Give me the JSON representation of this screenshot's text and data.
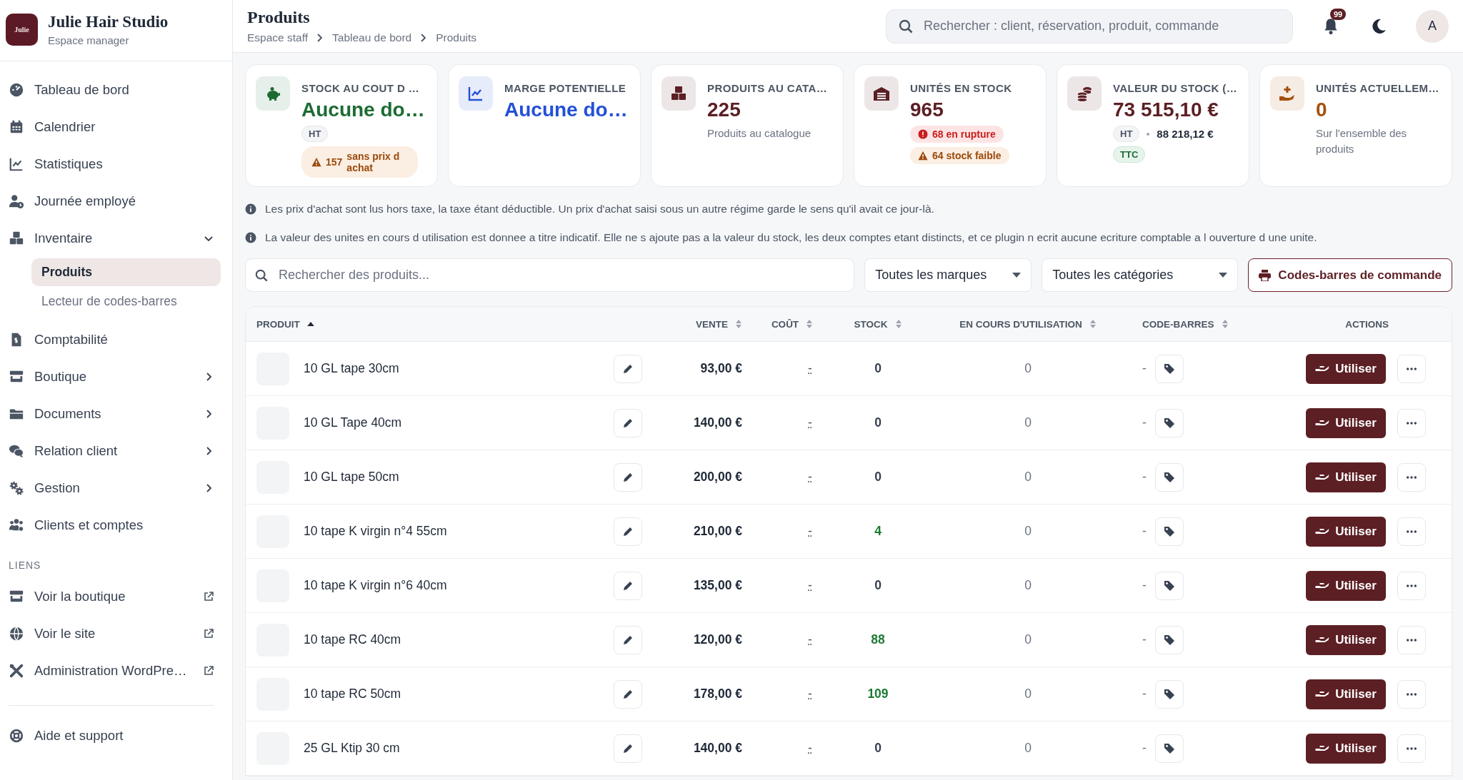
{
  "brand": {
    "logo_text": "Julie",
    "name": "Julie Hair Studio",
    "subtitle": "Espace manager"
  },
  "nav": [
    {
      "label": "Tableau de bord"
    },
    {
      "label": "Calendrier"
    },
    {
      "label": "Statistiques"
    },
    {
      "label": "Journée employé"
    },
    {
      "label": "Inventaire",
      "expanded": true,
      "children": [
        {
          "label": "Produits",
          "selected": true
        },
        {
          "label": "Lecteur de codes-barres",
          "selected": false
        }
      ]
    },
    {
      "label": "Comptabilité"
    },
    {
      "label": "Boutique",
      "expanded": false
    },
    {
      "label": "Documents",
      "expanded": false
    },
    {
      "label": "Relation client",
      "expanded": false
    },
    {
      "label": "Gestion",
      "expanded": false
    },
    {
      "label": "Clients et comptes"
    }
  ],
  "links_heading": "LIENS",
  "links": [
    {
      "label": "Voir la boutique"
    },
    {
      "label": "Voir le site"
    },
    {
      "label": "Administration WordPre…"
    }
  ],
  "help": {
    "label": "Aide et support"
  },
  "header": {
    "title": "Produits",
    "breadcrumb": [
      "Espace staff",
      "Tableau de bord",
      "Produits"
    ],
    "search_placeholder": "Rechercher : client, réservation, produit, commande",
    "notifications": "99",
    "avatar": "A"
  },
  "cards": [
    {
      "title": "STOCK AU COUT D …",
      "value": "Aucune do…",
      "color": "#1d6b33",
      "rows": [
        {
          "items": [
            {
              "kind": "tag",
              "text": "HT"
            }
          ]
        },
        {
          "items": [
            {
              "kind": "warning",
              "count": "157",
              "text": "sans prix d achat"
            }
          ]
        }
      ]
    },
    {
      "title": "MARGE POTENTIELLE",
      "value": "Aucune do…",
      "color": "#2350d8"
    },
    {
      "title": "PRODUITS AU CATA…",
      "value": "225",
      "color": "#5c1f24",
      "rows": [
        {
          "items": [
            {
              "kind": "note",
              "text": "Produits au catalogue"
            }
          ]
        }
      ]
    },
    {
      "title": "UNITÉS EN STOCK",
      "value": "965",
      "color": "#5c1f24",
      "rows": [
        {
          "items": [
            {
              "kind": "error",
              "text": "68 en rupture"
            }
          ]
        },
        {
          "items": [
            {
              "kind": "warning",
              "text": "64 stock faible"
            }
          ]
        }
      ]
    },
    {
      "title": "VALEUR DU STOCK (…",
      "value": "73 515,10 €",
      "color": "#5c1f24",
      "rows": [
        {
          "items": [
            {
              "kind": "tag",
              "text": "HT"
            },
            {
              "kind": "amount",
              "text": "88 218,12 €"
            }
          ]
        },
        {
          "items": [
            {
              "kind": "tag-green",
              "text": "TTC"
            }
          ]
        }
      ]
    },
    {
      "title": "UNITÉS ACTUELLEM…",
      "value": "0",
      "color": "#a4500c",
      "rows": [
        {
          "items": [
            {
              "kind": "note",
              "text": "Sur l'ensemble des produits"
            }
          ]
        }
      ]
    }
  ],
  "notes": [
    "Les prix d'achat sont lus hors taxe, la taxe étant déductible. Un prix d'achat saisi sous un autre régime garde le sens qu'il avait ce jour-là.",
    "La valeur des unites en cours d utilisation est donnee a titre indicatif. Elle ne s ajoute pas a la valeur du stock, les deux comptes etant distincts, et ce plugin n ecrit aucune ecriture comptable a l ouverture d une unite."
  ],
  "filters": {
    "search_placeholder": "Rechercher des produits...",
    "brand": "Toutes les marques",
    "category": "Toutes les catégories",
    "barcode_button": "Codes-barres de commande"
  },
  "table": {
    "columns": [
      {
        "label": "PRODUIT",
        "sorted": true
      },
      {
        "label": "VENTE",
        "sorted": false
      },
      {
        "label": "COÛT",
        "sorted": false
      },
      {
        "label": "STOCK",
        "sorted": false
      },
      {
        "label": "EN COURS D'UTILISATION",
        "sorted": false
      },
      {
        "label": "CODE-BARRES",
        "sorted": false
      },
      {
        "label": "ACTIONS"
      }
    ],
    "rows": [
      {
        "name": "10 GL tape 30cm",
        "price": "93,00 €",
        "cost": "-",
        "stock": "0",
        "in_stock": false,
        "in_use": "0",
        "barcode": "-",
        "action": "Utiliser"
      },
      {
        "name": "10 GL Tape 40cm",
        "price": "140,00 €",
        "cost": "-",
        "stock": "0",
        "in_stock": false,
        "in_use": "0",
        "barcode": "-",
        "action": "Utiliser"
      },
      {
        "name": "10 GL tape 50cm",
        "price": "200,00 €",
        "cost": "-",
        "stock": "0",
        "in_stock": false,
        "in_use": "0",
        "barcode": "-",
        "action": "Utiliser"
      },
      {
        "name": "10 tape K virgin n°4 55cm",
        "price": "210,00 €",
        "cost": "-",
        "stock": "4",
        "in_stock": true,
        "in_use": "0",
        "barcode": "-",
        "action": "Utiliser"
      },
      {
        "name": "10 tape K virgin n°6 40cm",
        "price": "135,00 €",
        "cost": "-",
        "stock": "0",
        "in_stock": false,
        "in_use": "0",
        "barcode": "-",
        "action": "Utiliser"
      },
      {
        "name": "10 tape RC 40cm",
        "price": "120,00 €",
        "cost": "-",
        "stock": "88",
        "in_stock": true,
        "in_use": "0",
        "barcode": "-",
        "action": "Utiliser"
      },
      {
        "name": "10 tape RC 50cm",
        "price": "178,00 €",
        "cost": "-",
        "stock": "109",
        "in_stock": true,
        "in_use": "0",
        "barcode": "-",
        "action": "Utiliser"
      },
      {
        "name": "25 GL Ktip 30 cm",
        "price": "140,00 €",
        "cost": "-",
        "stock": "0",
        "in_stock": false,
        "in_use": "0",
        "barcode": "-",
        "action": "Utiliser"
      }
    ]
  }
}
